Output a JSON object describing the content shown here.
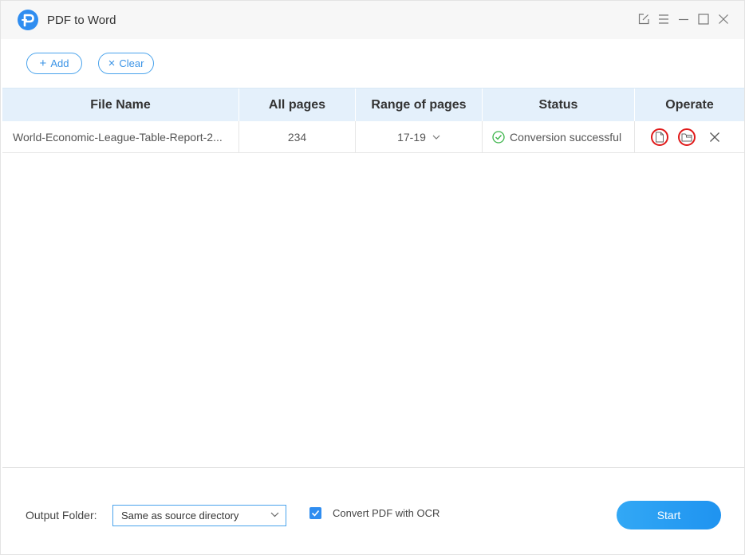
{
  "app": {
    "title": "PDF to Word"
  },
  "window_controls": [
    "edit-icon",
    "menu-icon",
    "minimize-icon",
    "maximize-icon",
    "close-icon"
  ],
  "toolbar": {
    "add_label": "Add",
    "clear_label": "Clear"
  },
  "table": {
    "headers": [
      "File Name",
      "All pages",
      "Range of pages",
      "Status",
      "Operate"
    ],
    "rows": [
      {
        "file_name": "World-Economic-League-Table-Report-2...",
        "all_pages": "234",
        "range": "17-19",
        "status": "Conversion successful"
      }
    ]
  },
  "footer": {
    "output_label": "Output Folder:",
    "output_value": "Same as source directory",
    "ocr_label": "Convert PDF with OCR",
    "ocr_checked": true,
    "start_label": "Start"
  },
  "colors": {
    "accent": "#2f8df0",
    "header_bg": "#e4f0fb",
    "success": "#3cb44a",
    "highlight": "#e01919"
  }
}
